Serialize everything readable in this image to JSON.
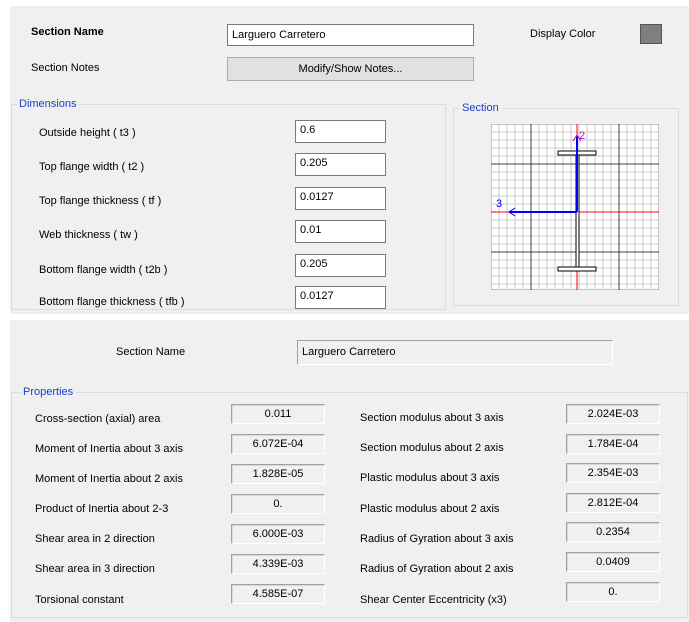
{
  "top_panel": {
    "section_name_label": "Section Name",
    "section_name_value": "Larguero Carretero",
    "display_color_label": "Display Color",
    "display_color_hex": "#7f7f7f",
    "section_notes_label": "Section Notes",
    "notes_button_label": "Modify/Show Notes..."
  },
  "dimensions": {
    "title": "Dimensions",
    "fields": [
      {
        "label": "Outside height  ( t3 )",
        "value": "0.6"
      },
      {
        "label": "Top flange width  ( t2 )",
        "value": "0.205"
      },
      {
        "label": "Top flange thickness  ( tf )",
        "value": "0.0127"
      },
      {
        "label": "Web thickness  ( tw )",
        "value": "0.01"
      },
      {
        "label": "Bottom flange width  ( t2b )",
        "value": "0.205"
      },
      {
        "label": "Bottom flange thickness  ( tfb )",
        "value": "0.0127"
      }
    ]
  },
  "section_preview": {
    "title": "Section",
    "axis2_label": "2",
    "axis3_label": "3",
    "colors": {
      "axis2": "#cc00cc",
      "axis3_arrow": "#0000ff",
      "center_line": "#ff0000",
      "section": "#000000"
    }
  },
  "properties_panel": {
    "section_name_label": "Section Name",
    "section_name_value": "Larguero Carretero",
    "title": "Properties",
    "left": [
      {
        "label": "Cross-section (axial) area",
        "value": "0.011"
      },
      {
        "label": "Moment of Inertia about 3 axis",
        "value": "6.072E-04"
      },
      {
        "label": "Moment of Inertia about 2 axis",
        "value": "1.828E-05"
      },
      {
        "label": "Product of Inertia about 2-3",
        "value": "0."
      },
      {
        "label": "Shear area in 2 direction",
        "value": "6.000E-03"
      },
      {
        "label": "Shear area in 3 direction",
        "value": "4.339E-03"
      },
      {
        "label": "Torsional constant",
        "value": "4.585E-07"
      }
    ],
    "right": [
      {
        "label": "Section modulus about 3 axis",
        "value": "2.024E-03"
      },
      {
        "label": "Section modulus about 2 axis",
        "value": "1.784E-04"
      },
      {
        "label": "Plastic modulus about 3 axis",
        "value": "2.354E-03"
      },
      {
        "label": "Plastic modulus about 2 axis",
        "value": "2.812E-04"
      },
      {
        "label": "Radius of Gyration about 3 axis",
        "value": "0.2354"
      },
      {
        "label": "Radius of Gyration about 2 axis",
        "value": "0.0409"
      },
      {
        "label": "Shear Center Eccentricity (x3)",
        "value": "0."
      }
    ]
  }
}
